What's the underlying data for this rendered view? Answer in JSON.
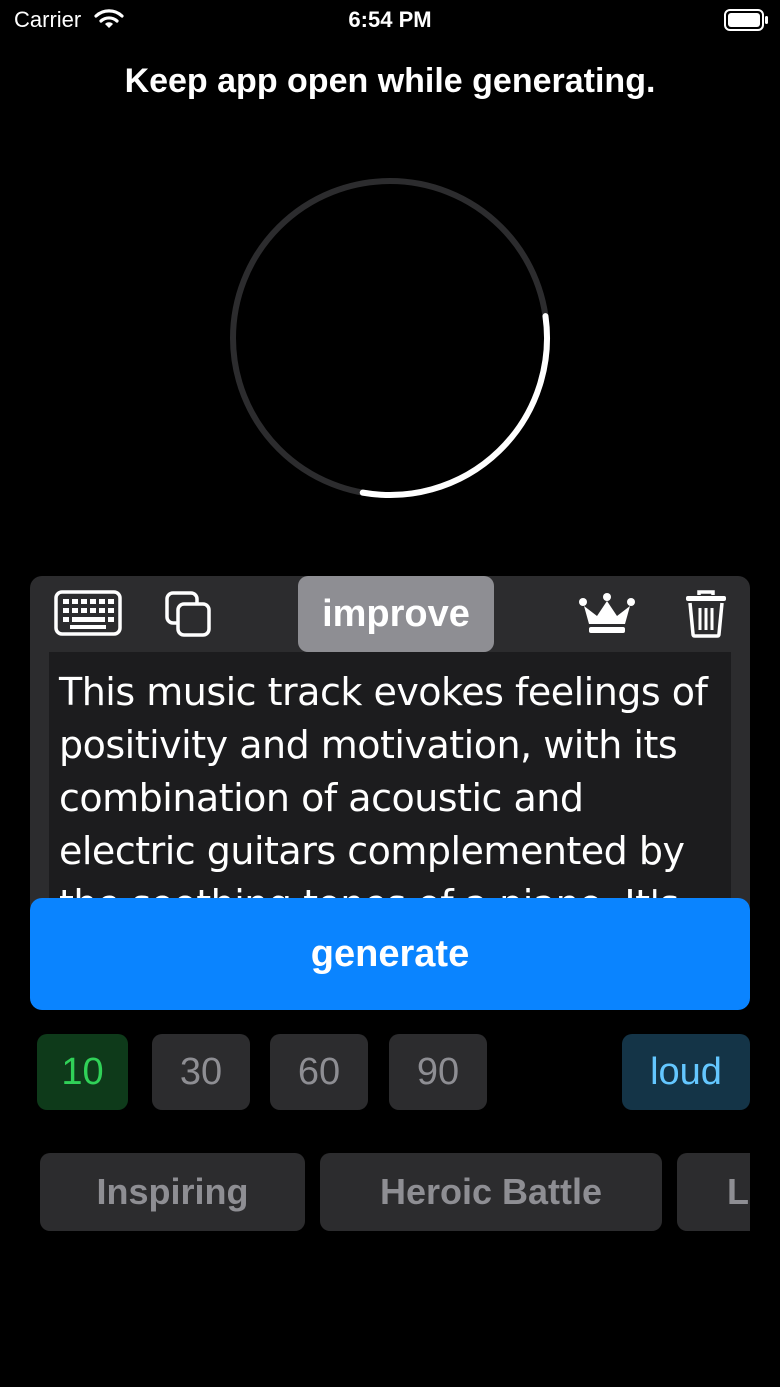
{
  "status_bar": {
    "carrier": "Carrier",
    "time": "6:54 PM"
  },
  "notice": "Keep app open while generating.",
  "progress": {
    "fraction": 0.3
  },
  "toolbar": {
    "improve_label": "improve",
    "icons": [
      "keyboard-icon",
      "copy-icon",
      "crown-icon",
      "trash-icon"
    ]
  },
  "prompt": {
    "text": "This music track evokes feelings of positivity and motivation, with its combination of acoustic and electric guitars complemented by the soothing tones of a piano. It's the"
  },
  "generate_label": "generate",
  "durations": [
    {
      "label": "10",
      "selected": true
    },
    {
      "label": "30",
      "selected": false
    },
    {
      "label": "60",
      "selected": false
    },
    {
      "label": "90",
      "selected": false
    }
  ],
  "loud_label": "loud",
  "styles": [
    "Inspiring",
    "Heroic Battle",
    "L"
  ],
  "colors": {
    "accent": "#0a84ff",
    "selected_duration": "#30d158",
    "loud": "#64c7ff"
  }
}
